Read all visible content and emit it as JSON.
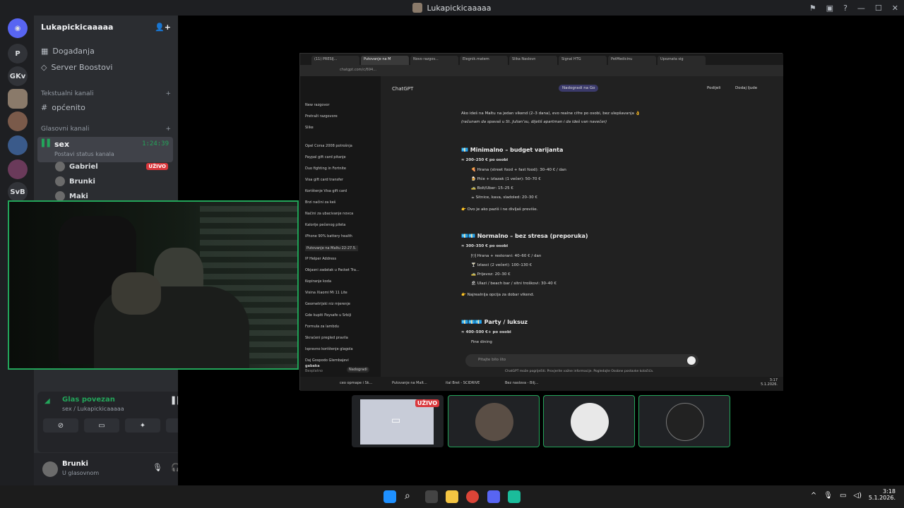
{
  "window": {
    "title": "Lukapickicaaaaa"
  },
  "server": {
    "name": "Lukapickicaaaaa",
    "events": "Događanja",
    "boosts": "Server Boostovi",
    "text_category": "Tekstualni kanali",
    "text_channel": "općenito",
    "voice_category": "Glasovni kanali",
    "voice_channel": "sex",
    "voice_timer": "1:24:39",
    "voice_status": "Postavi status kanala",
    "members": [
      {
        "name": "Gabriel",
        "badge": "UŽIVO"
      },
      {
        "name": "Brunki",
        "badge": ""
      },
      {
        "name": "Maki",
        "badge": ""
      }
    ]
  },
  "guilds": [
    "P",
    "GKv",
    "SvB"
  ],
  "voice_panel": {
    "status": "Glas povezan",
    "location": "sex / Lukapickicaaaaa"
  },
  "user": {
    "name": "Brunki",
    "status": "U glasovnom"
  },
  "stream": {
    "tabs": [
      "(11) PRESIJ...",
      "Putovanje na M",
      "Novo razgov...",
      "Elegnik.matem",
      "Slika Naslovn",
      "Signal HTG",
      "PetMedicinu",
      "Upoznata sig"
    ],
    "url": "chatgpt.com/c/694...",
    "app_title": "ChatGPT",
    "upgrade": "Nadogradi na Go",
    "share": "Podijeli",
    "add_people": "Dodaj ljude",
    "sidebar_top": [
      "New razgovor",
      "Pretraži razgovore",
      "Slike"
    ],
    "history": [
      "Opel Corsa 2008 potrošnja",
      "Paypal gift card pitanje",
      "Duo fighting in Fortnite",
      "Visa gift card transfer",
      "Korištenje Visa gift card",
      "Brzi načini za keš",
      "Načini za ubacivanje novca",
      "Kalorije pečenog pileta",
      "iPhone 90% battery health",
      "Putovanje na Maltu 22-27.5.",
      "IP Helper Address",
      "Objasni zadatak u Packet Tra...",
      "Kopiranje koda",
      "Visina Xiaomi Mi 11 Lite",
      "Geometrijski niz mjerenje",
      "Gde kupiti Paysafe u Srbiji",
      "Formula za lambdu",
      "Skraćeni pregled pravila",
      "Ispravno korištenje glagola",
      "Daj Gospodo Glembajevi"
    ],
    "account_name": "gabaka",
    "account_plan": "Besplatno",
    "account_upgrade": "Nadogradi",
    "intro": "Ako ideš na Maltu na jedan vikend (2–3 dana), evo realne cifre po osobi, bez ulepšavanja 👌",
    "intro2": "(računam da spavaš u St. Julian’su, dijeliš apartman i da ideš van navečer)",
    "s1_title": "💶 Minimalno – budget varijanta",
    "s1_range": "≈ 200–250 € po osobi",
    "s1_items": [
      "🍕 Hrana (street food + fast food): 30–40 € / dan",
      "🍺 Piće + izlazak (1 večer): 50–70 €",
      "🚕 Bolt/Uber: 15–25 €",
      "☕ Sitnice, kava, sladoled: 20–30 €"
    ],
    "s1_note": "👉 Ovo je ako paziš i ne divljaš previše.",
    "s2_title": "💶💶 Normalno – bez stresa (preporuka)",
    "s2_range": "≈ 300–350 € po osobi",
    "s2_items": [
      "🍽 Hrana + restorani: 40–60 € / dan",
      "🍸 Izlasci (2 večeri): 100–130 €",
      "🚕 Prijevoz: 20–30 €",
      "🏖 Ulazi / beach bar / sitni troškovi: 30–40 €"
    ],
    "s2_note": "👉 Najrealnija opcija za dobar vikend.",
    "s3_title": "💶💶💶 Party / luksuz",
    "s3_range": "≈ 400–500 €+ po osobi",
    "s3_items": [
      "Fine dining"
    ],
    "input_placeholder": "Pitajte bilo što",
    "disclaimer": "ChatGPT može pogriješiti. Provjerite važne informacije. Pogledajte Osobne postavke kolačića.",
    "taskbar_items": [
      "ceo opmape i Sk...",
      "Putovanje na Malt...",
      "ital Bret - SCIDRIVE",
      "Bez naslova - Bilj..."
    ],
    "clock": "3:17",
    "date_small": "5.1.2026."
  },
  "thumbs": [
    {
      "badge": "UŽIVO"
    },
    {},
    {},
    {}
  ],
  "taskbar": {
    "time": "3:18",
    "date": "5.1.2026."
  }
}
